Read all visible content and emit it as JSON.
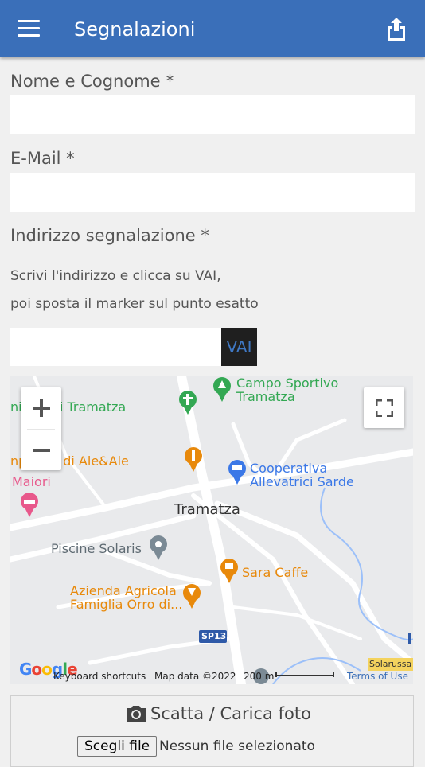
{
  "appbar": {
    "title": "Segnalazioni"
  },
  "form": {
    "name_label": "Nome e Cognome *",
    "name_value": "",
    "email_label": "E-Mail *",
    "email_value": "",
    "address_label": "Indirizzo segnalazione *",
    "address_hint_1": "Scrivi l'indirizzo e clicca su VAI,",
    "address_hint_2": "poi sposta il marker sul punto esatto",
    "address_value": "",
    "go_button": "VAI"
  },
  "map": {
    "place_name": "Tramatza",
    "pois": {
      "campo_1": "Campo Sportivo",
      "campo_2": "Tramatza",
      "cimitero": "nitero di Tramatza",
      "pizzeria": "npiazza di Ale&Ale",
      "coop_1": "Cooperativa",
      "coop_2": "Allevatrici Sarde",
      "maiori": "Maiori",
      "piscine": "Piscine Solaris",
      "sara": "Sara Caffe",
      "azienda_1": "Azienda Agricola",
      "azienda_2": "Famiglia Orro di...",
      "road": "SP13",
      "solarussa": "Solarussa"
    },
    "google": "Google",
    "keyboard_shortcuts": "Keyboard shortcuts",
    "map_data": "Map data ©2022",
    "scale": "200 m",
    "terms": "Terms of Use",
    "colors": {
      "green_poi": "#33a853",
      "orange_poi": "#e8890b",
      "blue_poi": "#3b78e7",
      "pink_poi": "#e8588b",
      "grey_poi": "#7b8a95"
    }
  },
  "photo": {
    "title": "Scatta / Carica foto",
    "choose_file": "Scegli file",
    "no_file": "Nessun file selezionato"
  }
}
